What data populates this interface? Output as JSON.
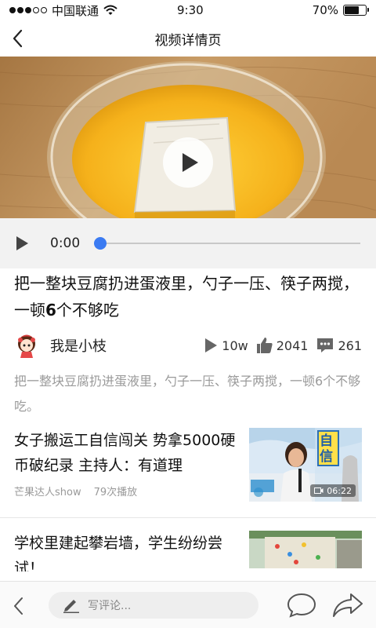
{
  "status": {
    "carrier": "中国联通",
    "time": "9:30",
    "battery": "70%",
    "battery_level": 0.7
  },
  "nav": {
    "title": "视频详情页"
  },
  "player": {
    "time": "0:00",
    "progress": 0
  },
  "article": {
    "headline_before": "把一整块豆腐扔进蛋液里，勺子一压、筷子两搅，一顿",
    "headline_bold": "6",
    "headline_after": "个不够吃",
    "author": "我是小枝",
    "views": "10w",
    "likes": "2041",
    "comments": "261",
    "summary": "把一整块豆腐扔进蛋液里，勺子一压、筷子两搅，一顿6个不够吃。"
  },
  "related": [
    {
      "title": "女子搬运工自信闯关 势拿5000硬币破纪录 主持人：有道理",
      "source": "芒果达人show",
      "plays": "79次播放",
      "duration": "06:22",
      "thumb_text": "自信"
    },
    {
      "title": "学校里建起攀岩墙，学生纷纷尝试！"
    }
  ],
  "bottom": {
    "comment_placeholder": "写评论..."
  },
  "colors": {
    "accent": "#3b7bf2",
    "meta": "#999999"
  }
}
